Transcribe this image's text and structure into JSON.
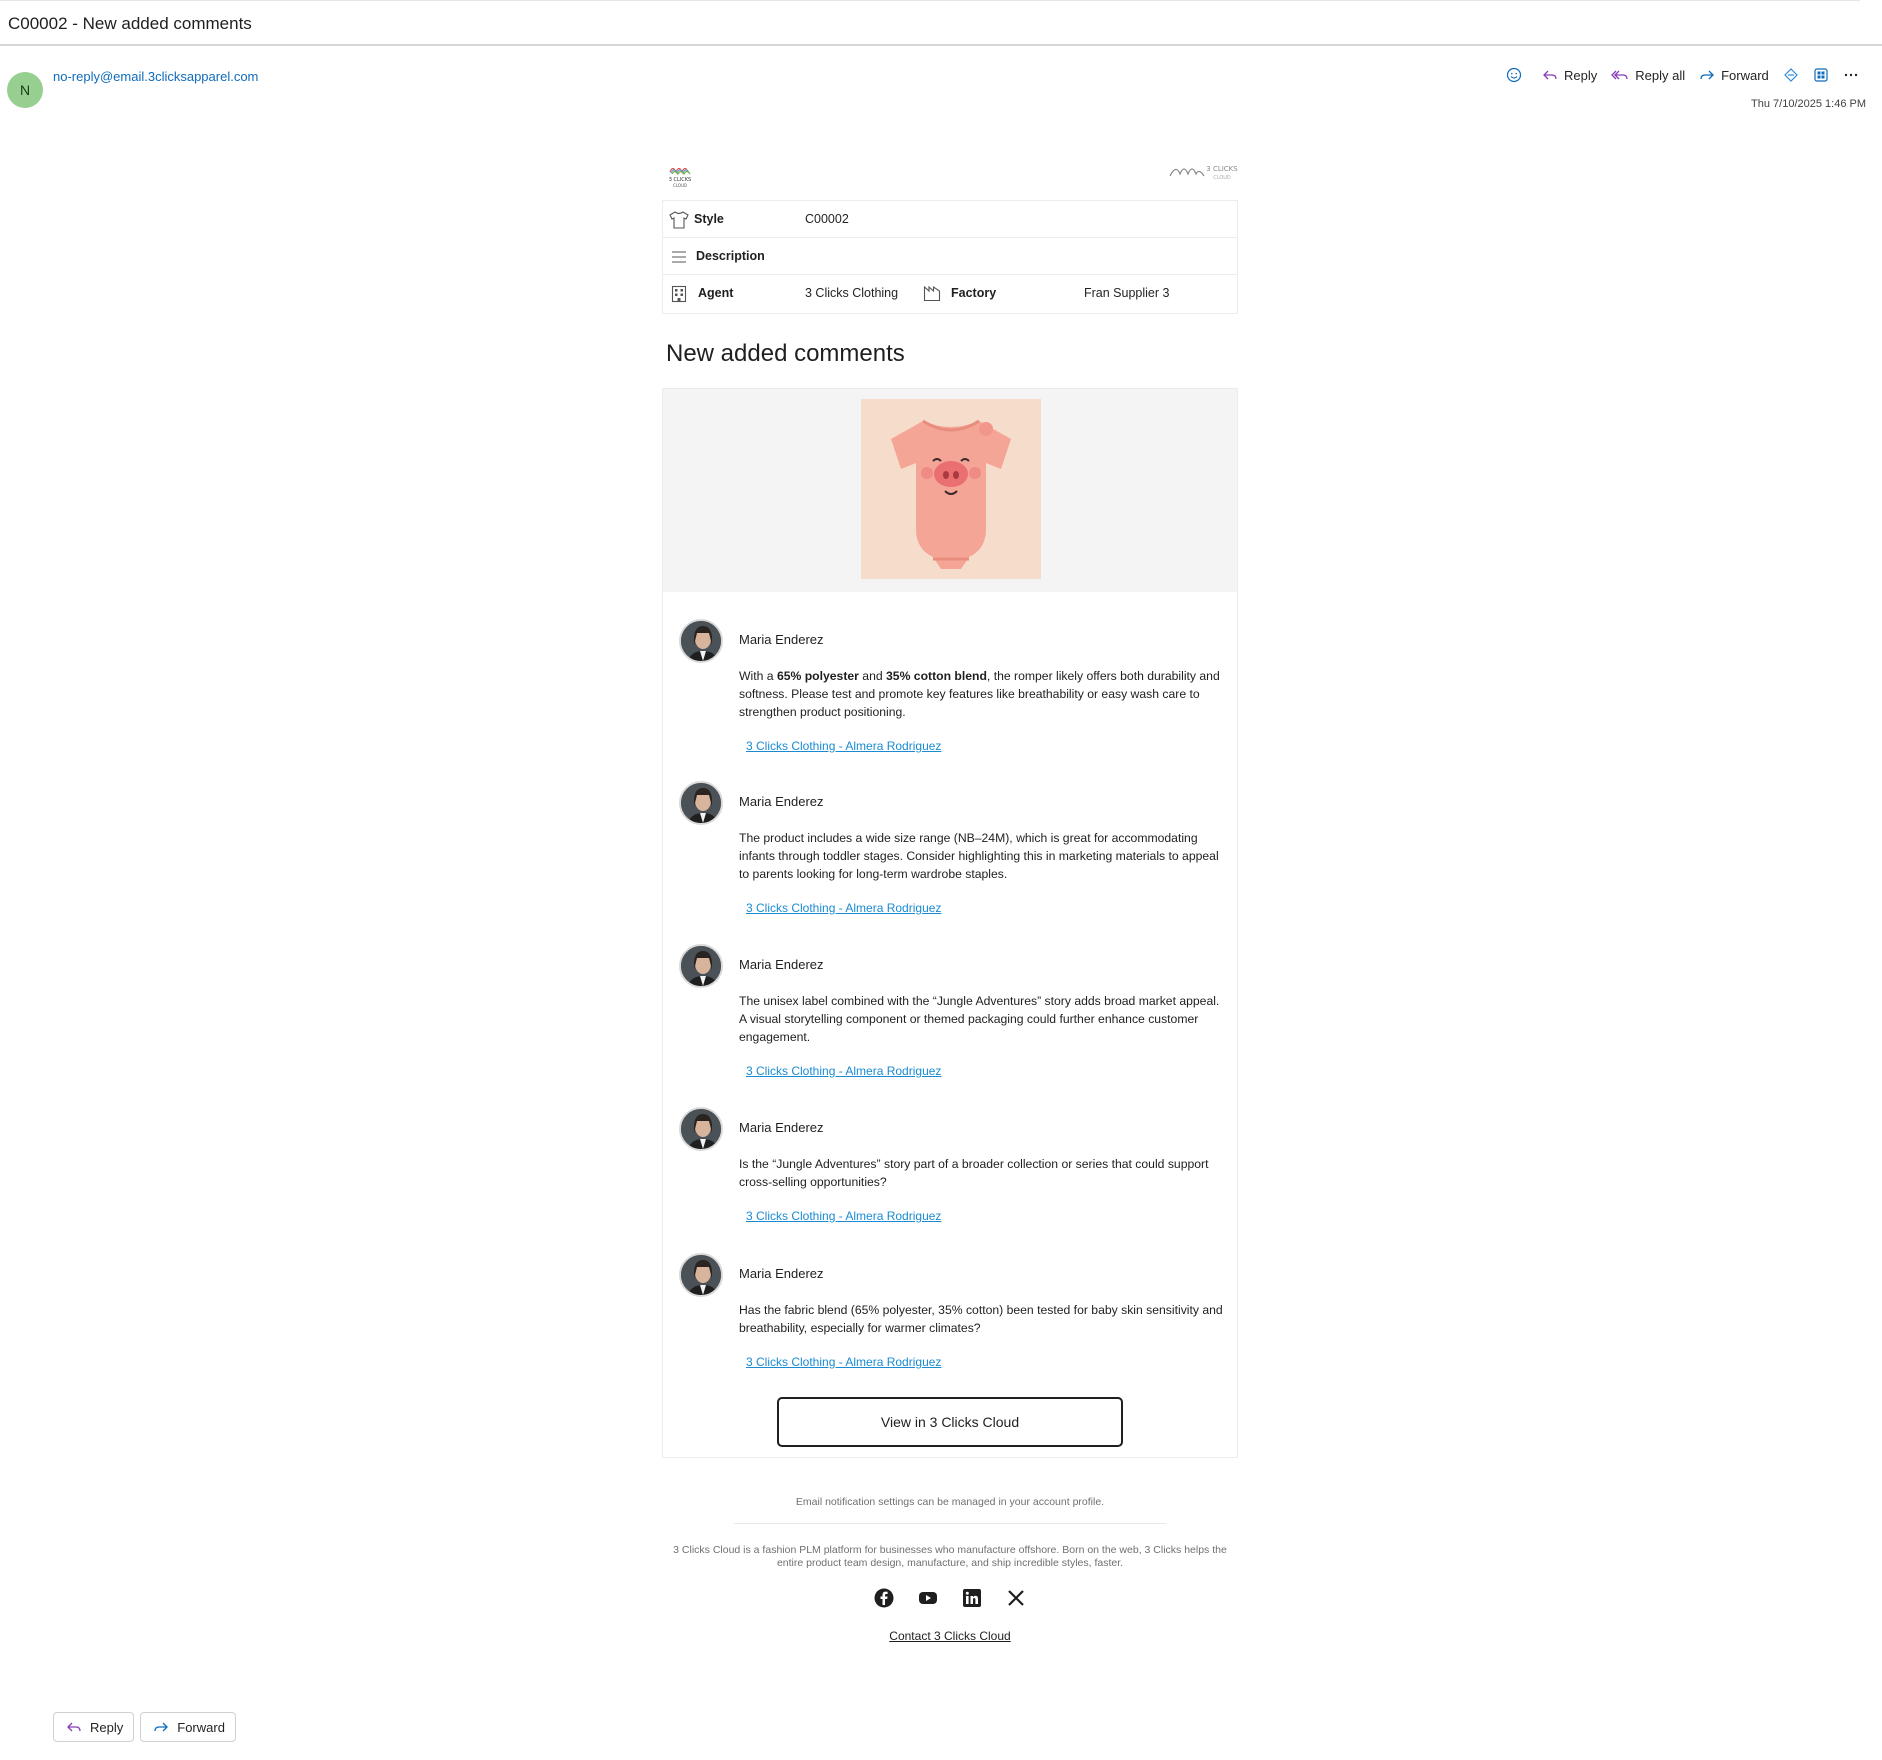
{
  "subject": "C00002 - New added comments",
  "sender": {
    "initial": "N",
    "address": "no-reply@email.3clicksapparel.com",
    "avatar_color": "#96cf8f"
  },
  "actions": {
    "reply": "Reply",
    "reply_all": "Reply all",
    "forward": "Forward"
  },
  "date": "Thu 7/10/2025 1:46 PM",
  "style_info": {
    "style_label": "Style",
    "style_value": "C00002",
    "description_label": "Description",
    "description_value": "",
    "agent_label": "Agent",
    "agent_value": "3 Clicks Clothing",
    "factory_label": "Factory",
    "factory_value": "Fran Supplier 3"
  },
  "heading": "New added comments",
  "comments": [
    {
      "author": "Maria Enderez",
      "link": "3 Clicks Clothing - Almera Rodriguez"
    },
    {
      "author": "Maria Enderez",
      "text": "The product includes a wide size range (NB–24M), which is great for accommodating infants through toddler stages. Consider highlighting this in marketing materials to appeal to parents looking for long-term wardrobe staples.",
      "link": "3 Clicks Clothing - Almera Rodriguez"
    },
    {
      "author": "Maria Enderez",
      "text": "The unisex label combined with the “Jungle Adventures” story adds broad market appeal. A visual storytelling component or themed packaging could further enhance customer engagement.",
      "link": "3 Clicks Clothing - Almera Rodriguez"
    },
    {
      "author": "Maria Enderez",
      "text": "Is the “Jungle Adventures” story part of a broader collection or series that could support cross-selling opportunities?",
      "link": "3 Clicks Clothing - Almera Rodriguez"
    },
    {
      "author": "Maria Enderez",
      "text": "Has the fabric blend (65% polyester, 35% cotton) been tested for baby skin sensitivity and breathability, especially for warmer climates?",
      "link": "3 Clicks Clothing - Almera Rodriguez"
    }
  ],
  "first_comment_parts": {
    "p1": "With a ",
    "b1": "65% polyester",
    "p2": " and ",
    "b2": "35% cotton blend",
    "p3": ", the romper likely offers both durability and softness. Please test and promote key features like breathability or easy wash care to strengthen product positioning."
  },
  "view_button": "View in 3 Clicks Cloud",
  "footer": {
    "settings_note": "Email notification settings can be managed in your account profile.",
    "about": "3 Clicks Cloud is a fashion PLM platform for businesses who manufacture offshore. Born on the web, 3 Clicks helps the entire product team design, manufacture, and ship incredible styles, faster.",
    "contact": "Contact 3 Clicks Cloud",
    "social_icons": [
      "facebook-icon",
      "youtube-icon",
      "linkedin-icon",
      "x-icon"
    ]
  },
  "logo": {
    "small_text_1": "3 CLICKS",
    "small_text_2": "CLOUD"
  },
  "bottom": {
    "reply": "Reply",
    "forward": "Forward"
  }
}
